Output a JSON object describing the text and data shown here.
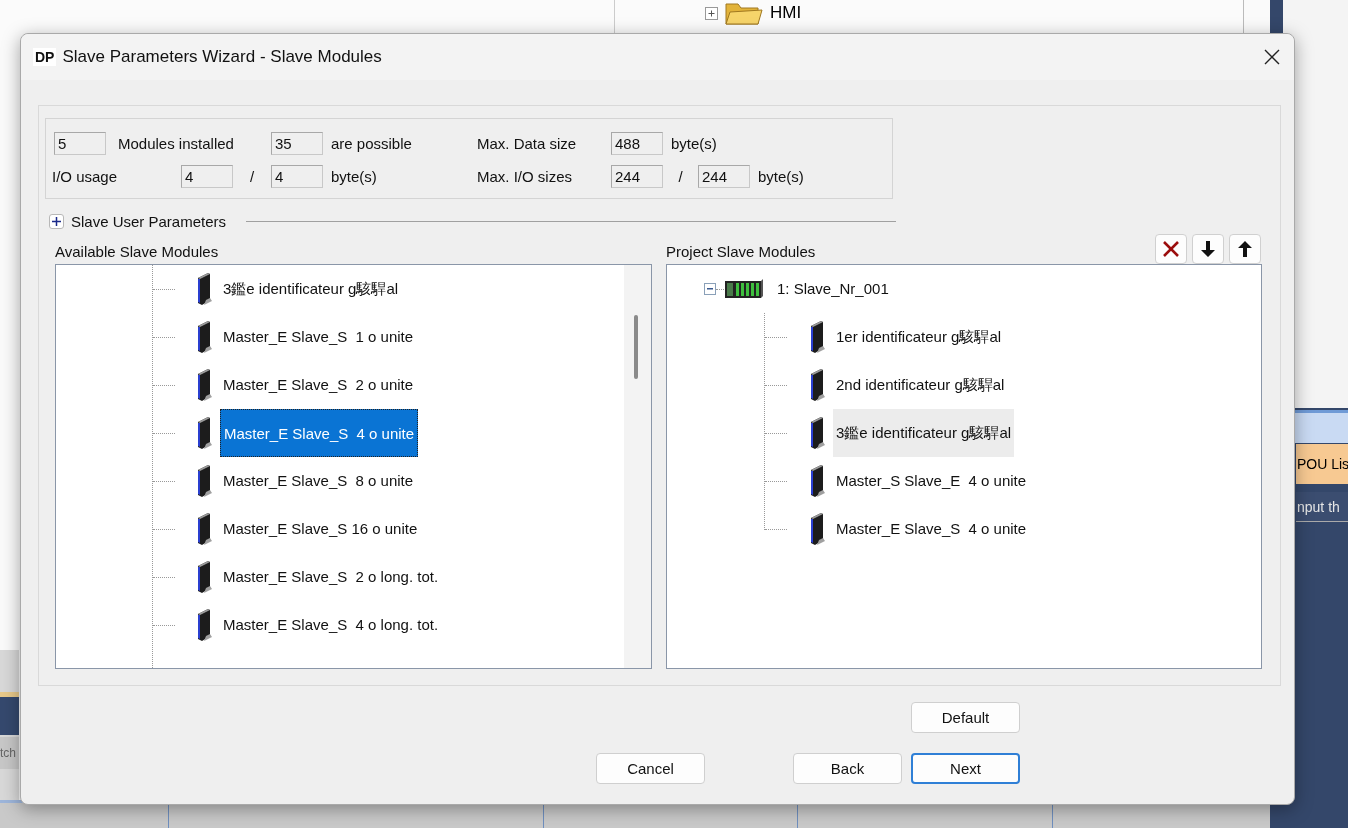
{
  "background_app": {
    "tree_item": "HMI",
    "tab": "POU Lis",
    "hint": "nput th",
    "left_tab": "tch"
  },
  "window": {
    "badge": "DP",
    "title": "Slave Parameters Wizard - Slave Modules"
  },
  "summary": {
    "modules_installed": {
      "value": "5",
      "label": "Modules installed"
    },
    "modules_possible": {
      "value": "35",
      "label": "are possible"
    },
    "max_data_size": {
      "label": "Max. Data size",
      "value": "488",
      "unit": "byte(s)"
    },
    "io_usage": {
      "label": "I/O usage",
      "input": "4",
      "separator": "/",
      "output": "4",
      "unit": "byte(s)"
    },
    "max_io_sizes": {
      "label": "Max. I/O sizes",
      "input": "244",
      "separator": "/",
      "output": "244",
      "unit": "byte(s)"
    }
  },
  "user_parameters": {
    "label": "Slave User Parameters",
    "expanded": false
  },
  "available_modules": {
    "title": "Available Slave Modules",
    "items": [
      {
        "label": "3鑑e identificateur g駭駻al",
        "selected": false
      },
      {
        "label": "Master_E Slave_S  1 o unite",
        "selected": false
      },
      {
        "label": "Master_E Slave_S  2 o unite",
        "selected": false
      },
      {
        "label": "Master_E Slave_S  4 o unite",
        "selected": true
      },
      {
        "label": "Master_E Slave_S  8 o unite",
        "selected": false
      },
      {
        "label": "Master_E Slave_S 16 o unite",
        "selected": false
      },
      {
        "label": "Master_E Slave_S  2 o long. tot.",
        "selected": false
      },
      {
        "label": "Master_E Slave_S  4 o long. tot.",
        "selected": false
      }
    ]
  },
  "project_modules": {
    "title": "Project Slave Modules",
    "toolbar": [
      {
        "kind": "delete"
      },
      {
        "kind": "move_down"
      },
      {
        "kind": "move_up"
      }
    ],
    "root": {
      "label": "1: Slave_Nr_001",
      "expanded": true,
      "children": [
        {
          "label": "1er identificateur g駭駻al",
          "selected": false
        },
        {
          "label": "2nd identificateur g駭駻al",
          "selected": false
        },
        {
          "label": "3鑑e identificateur g駭駻al",
          "selected": true
        },
        {
          "label": "Master_S Slave_E  4 o unite",
          "selected": false
        },
        {
          "label": "Master_E Slave_S  4 o unite",
          "selected": false
        }
      ]
    }
  },
  "buttons": [
    {
      "label": "Default",
      "focused": false
    },
    {
      "label": "Cancel",
      "focused": false
    },
    {
      "label": "Back",
      "focused": false
    },
    {
      "label": "Next",
      "focused": true
    }
  ]
}
